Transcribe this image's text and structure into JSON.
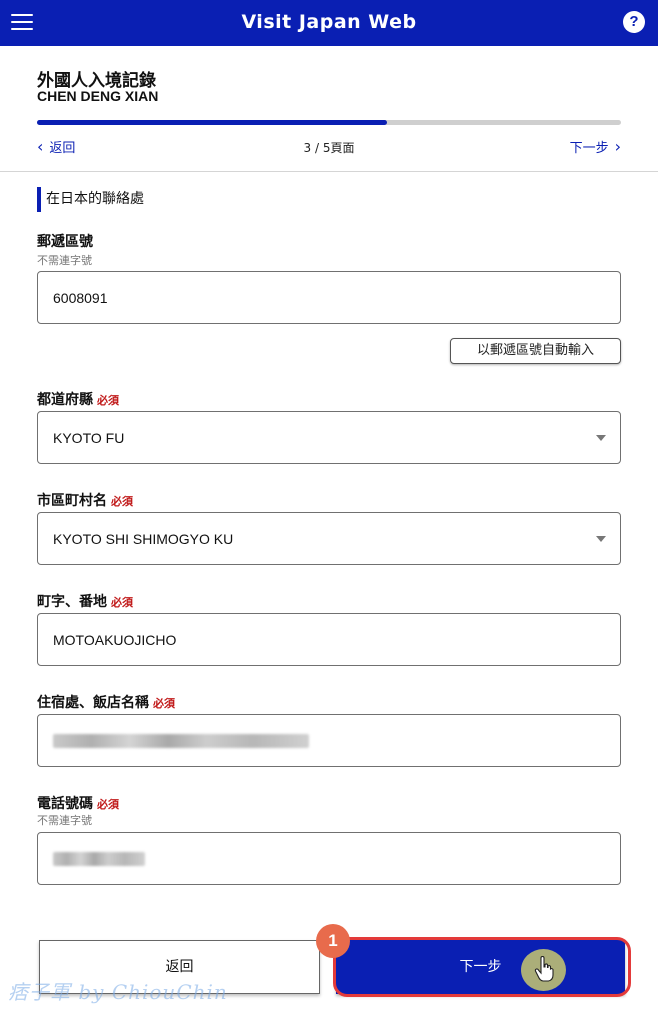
{
  "header": {
    "title": "Visit Japan Web",
    "help_symbol": "?",
    "menu_icon": "hamburger-icon",
    "help_icon": "help-icon"
  },
  "form": {
    "title": "外國人入境記錄",
    "traveler_name": "CHEN DENG XIAN"
  },
  "progress": {
    "fraction": 0.6,
    "step_label": "3 / 5頁面",
    "back_label": "返回",
    "next_label": "下一步"
  },
  "section": {
    "heading": "在日本的聯絡處"
  },
  "fields": {
    "postal": {
      "label": "郵遞區號",
      "hint": "不需連字號",
      "value": "6008091"
    },
    "auto_fill": {
      "label": "以郵遞區號自動輸入"
    },
    "prefecture": {
      "label": "都道府縣",
      "required": "必須",
      "value": "KYOTO FU"
    },
    "city": {
      "label": "市區町村名",
      "required": "必須",
      "value": "KYOTO SHI SHIMOGYO KU"
    },
    "street": {
      "label": "町字、番地",
      "required": "必須",
      "value": "MOTOAKUOJICHO"
    },
    "hotel": {
      "label": "住宿處、飯店名稱",
      "required": "必須"
    },
    "phone": {
      "label": "電話號碼",
      "required": "必須",
      "hint": "不需連字號"
    }
  },
  "footer": {
    "back_label": "返回",
    "next_label": "下一步",
    "step_badge": "1"
  },
  "watermark": "痞子軍 by ChiouChin",
  "colors": {
    "brand_blue": "#0a1fb3",
    "required_red": "#c01818",
    "annotation_red": "#e33a3a",
    "badge_orange": "#e86b4c"
  }
}
